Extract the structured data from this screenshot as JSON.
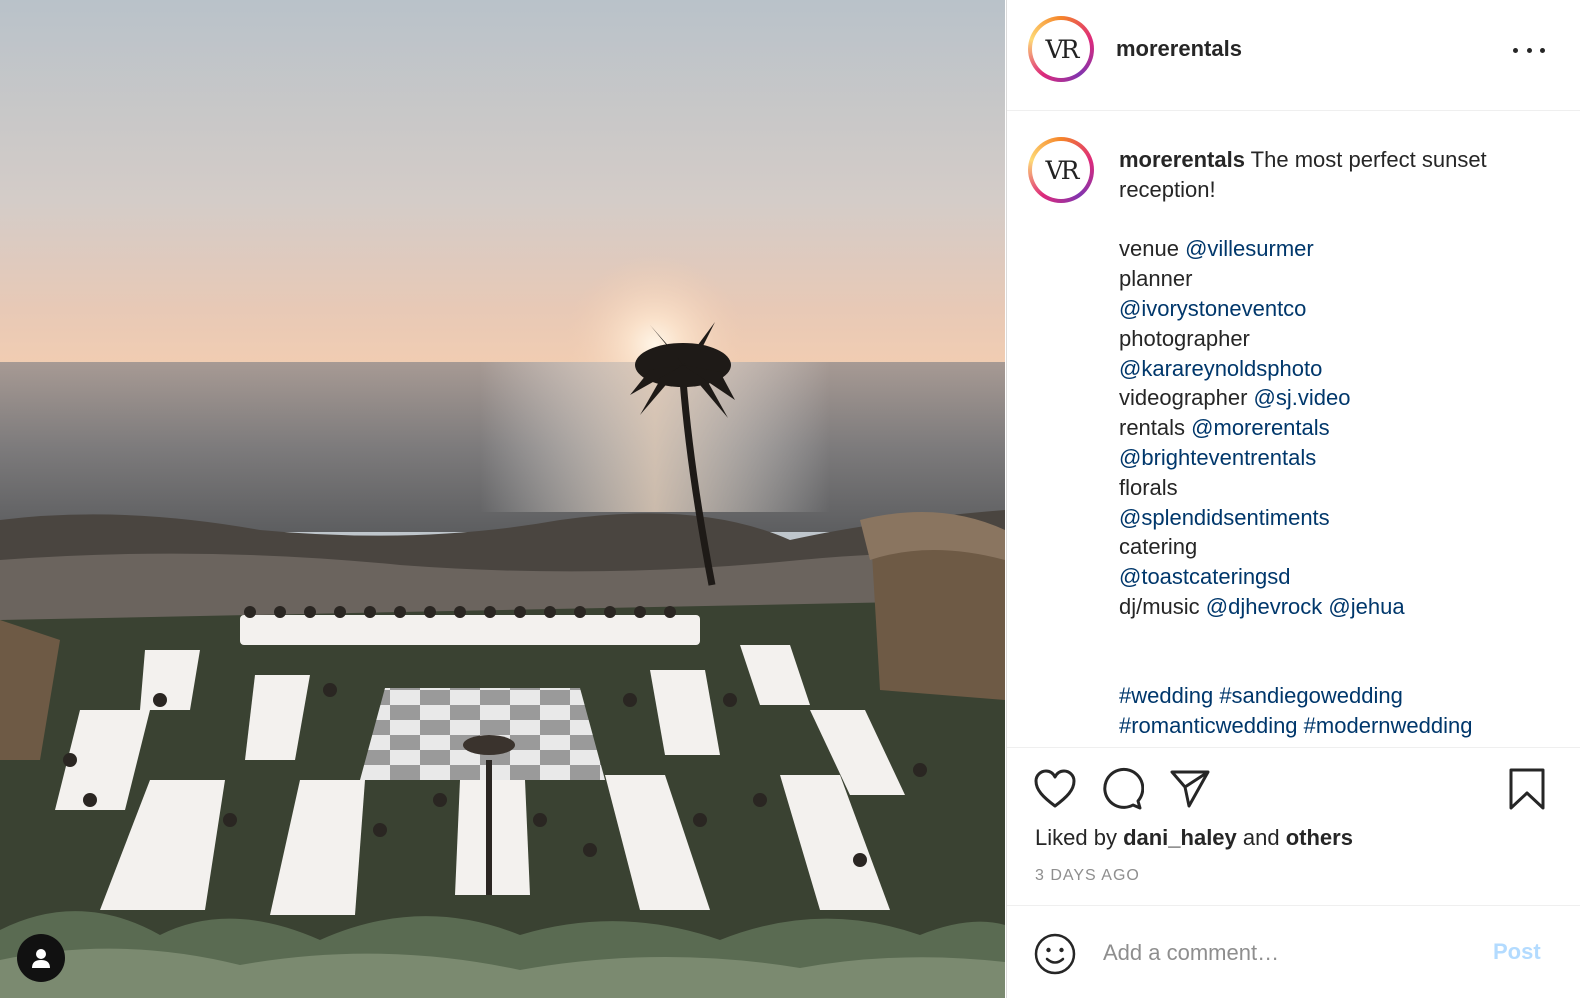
{
  "post": {
    "username": "morerentals",
    "avatar_initials": "VR",
    "image_alt": "Sunset reception overlooking the ocean with long dining tables around a checkered dance floor",
    "caption": {
      "username": "morerentals",
      "lead": " The most perfect sunset reception!",
      "credits": [
        {
          "label": "venue ",
          "handle": "@villesurmer"
        },
        {
          "label": "planner",
          "handle": ""
        },
        {
          "label": "",
          "handle": "@ivorystoneventco"
        },
        {
          "label": "photographer",
          "handle": ""
        },
        {
          "label": "",
          "handle": "@karareynoldsphoto"
        },
        {
          "label": "videographer ",
          "handle": "@sj.video"
        },
        {
          "label": "rentals ",
          "handle": "@morerentals"
        },
        {
          "label": "",
          "handle": "@brighteventrentals"
        },
        {
          "label": "florals",
          "handle": ""
        },
        {
          "label": "",
          "handle": "@splendidsentiments"
        },
        {
          "label": "catering",
          "handle": ""
        },
        {
          "label": "",
          "handle": "@toastcateringsd"
        }
      ],
      "dj_label": "dj/music ",
      "dj_handles": [
        "@djhevrock",
        "@jehua"
      ],
      "hashtags_line1": [
        "#wedding",
        "#sandiegowedding"
      ],
      "hashtags_line2": [
        "#romanticwedding",
        "#modernwedding"
      ]
    },
    "likes": {
      "prefix": "Liked by ",
      "user": "dani_haley",
      "middle": " and ",
      "others": "others"
    },
    "timestamp": "3 DAYS AGO"
  },
  "comment": {
    "placeholder": "Add a comment…",
    "post_label": "Post"
  },
  "icons": [
    "user-tag-icon",
    "more-options-icon",
    "heart-icon",
    "comment-icon",
    "share-icon",
    "bookmark-icon",
    "emoji-icon"
  ],
  "colors": {
    "link": "#00376b",
    "text": "#262626",
    "muted": "#8e8e8e",
    "post_disabled": "#b3dbff",
    "border": "#dbdbdb"
  }
}
